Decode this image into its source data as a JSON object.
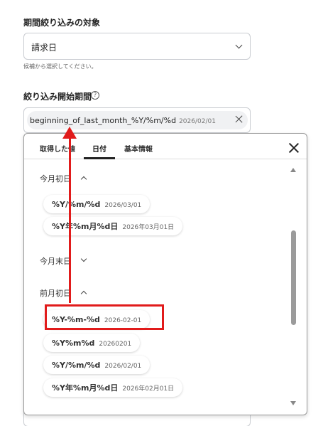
{
  "target_label": "期間絞り込みの対象",
  "target_select": {
    "value": "請求日",
    "help": "候補から選択してください。"
  },
  "start_label": "絞り込み開始期間",
  "start_help_icon": "?",
  "start_input": {
    "key": "beginning_of_last_month_%Y/%m/%d",
    "value": "2026/02/01"
  },
  "popup": {
    "tabs": [
      {
        "label": "取得した値",
        "active": false
      },
      {
        "label": "日付",
        "active": true
      },
      {
        "label": "基本情報",
        "active": false
      }
    ],
    "sections": [
      {
        "title": "今月初日",
        "expanded": true,
        "items": [
          {
            "key": "%Y/%m/%d",
            "value": "2026/03/01"
          },
          {
            "key": "%Y年%m月%d日",
            "value": "2026年03月01日"
          }
        ]
      },
      {
        "title": "今月末日",
        "expanded": false,
        "items": []
      },
      {
        "title": "前月初日",
        "expanded": true,
        "items": [
          {
            "key": "%Y-%m-%d",
            "value": "2026-02-01",
            "highlighted": true
          },
          {
            "key": "%Y%m%d",
            "value": "20260201"
          },
          {
            "key": "%Y/%m/%d",
            "value": "2026/02/01"
          },
          {
            "key": "%Y年%m月%d日",
            "value": "2026年02月01日"
          }
        ]
      }
    ]
  },
  "annotation_color": "#e11b1b"
}
